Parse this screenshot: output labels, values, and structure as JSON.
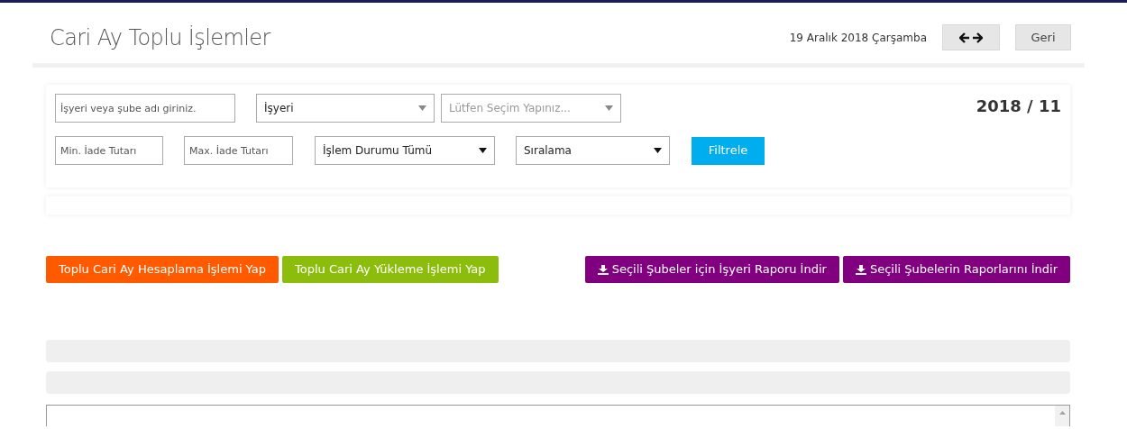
{
  "header": {
    "title": "Cari Ay Toplu İşlemler",
    "date": "19 Aralık 2018 Çarşamba",
    "back_button": "Geri"
  },
  "filters": {
    "period": "2018 / 11",
    "top_controls": [
      {
        "kind": "input",
        "placeholder": "İşyeri veya şube adı giriniz."
      },
      {
        "kind": "select",
        "value": "İşyeri"
      },
      {
        "kind": "select",
        "placeholder": "Lütfen Seçim Yapınız..."
      }
    ],
    "bottom_controls": [
      {
        "kind": "input",
        "placeholder": "Min. İade Tutarı"
      },
      {
        "kind": "input",
        "placeholder": "Max. İade Tutarı"
      },
      {
        "kind": "select",
        "value": "İşlem Durumu Tümü"
      },
      {
        "kind": "select",
        "value": "Sıralama"
      },
      {
        "kind": "button",
        "label": "Filtrele"
      }
    ]
  },
  "actions": [
    {
      "label": "Toplu Cari Ay Hesaplama İşlemi Yap",
      "color": "#ff5a00",
      "download": false
    },
    {
      "label": "Toplu Cari Ay Yükleme İşlemi Yap",
      "color": "#8cbd0c",
      "download": false
    },
    {
      "label": "Seçili Şubeler için İşyeri Raporu İndir",
      "color": "#80007f",
      "download": true
    },
    {
      "label": "Seçili Şubelerin Raporlarını İndir",
      "color": "#80007f",
      "download": true
    }
  ]
}
